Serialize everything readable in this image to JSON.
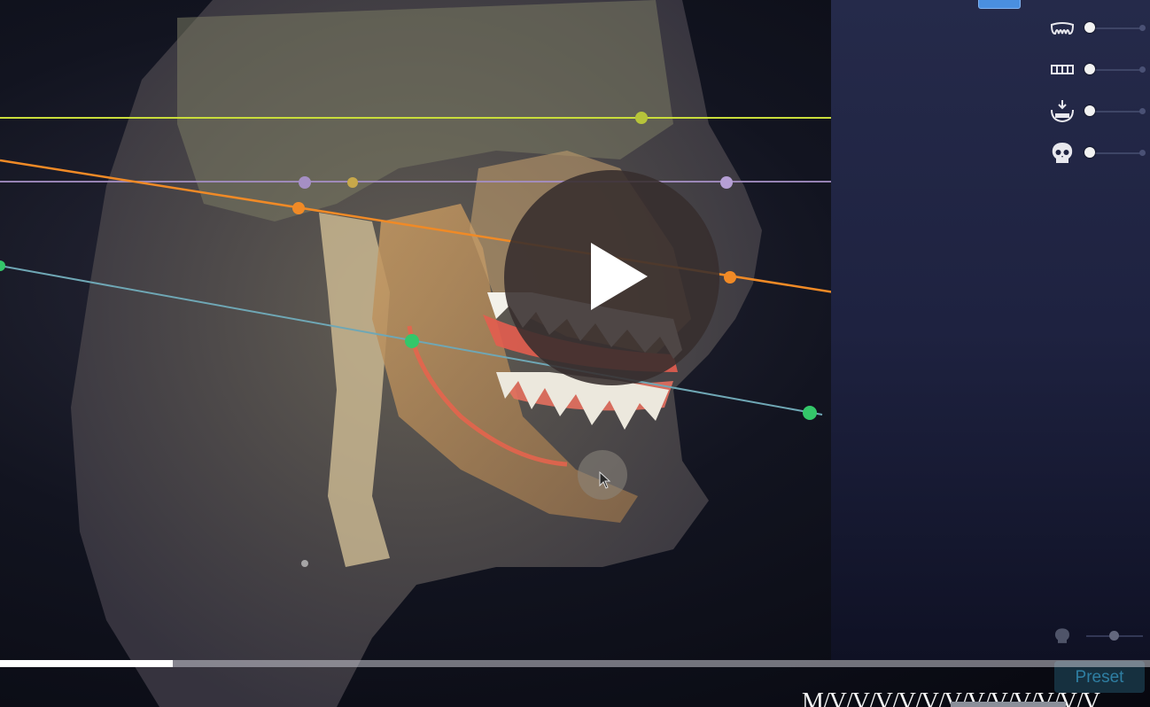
{
  "player": {
    "progress_fraction": 0.15,
    "play_icon": "play-icon"
  },
  "panel": {
    "sliders": [
      {
        "icon": "upper-teeth-icon",
        "value": 0
      },
      {
        "icon": "lower-teeth-icon",
        "value": 0
      },
      {
        "icon": "jaw-import-icon",
        "value": 0
      },
      {
        "icon": "skull-icon",
        "value": 0
      }
    ],
    "bottom_slider": {
      "icon": "skull-icon",
      "value": 0.5
    },
    "preset_label": "Preset"
  },
  "colors": {
    "accent_blue": "#4a8fe0",
    "line_yellow": "#c9dd3b",
    "line_orange": "#f08a26",
    "line_lilac": "#a58fc4",
    "line_teal": "#6fa7b5",
    "landmark_green": "#34c76a"
  },
  "caption": {
    "text": "M/V/V/V/V/V/V/V/V/V/V/V/V"
  }
}
